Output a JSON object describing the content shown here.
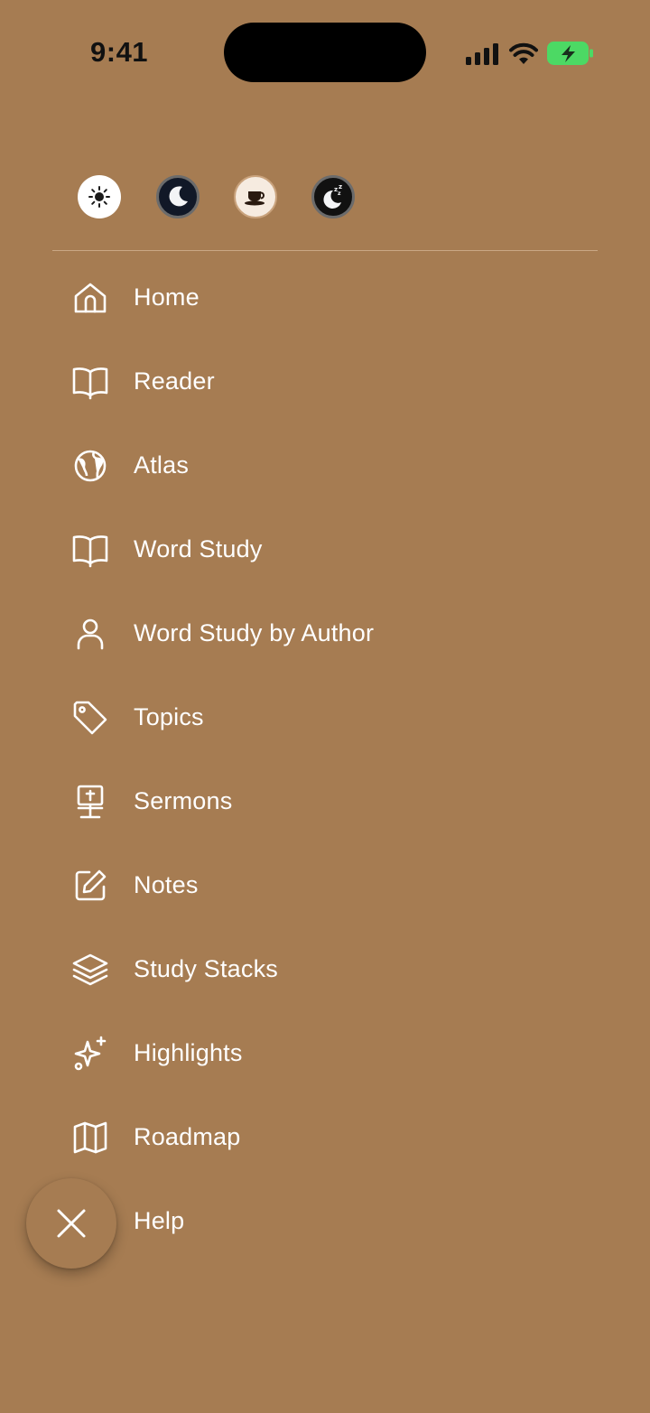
{
  "status_bar": {
    "time": "9:41"
  },
  "colors": {
    "background": "#a67c52",
    "text": "#ffffff",
    "battery_green": "#4cd964"
  },
  "theme_options": [
    {
      "name": "light",
      "icon": "sun-icon"
    },
    {
      "name": "dark",
      "icon": "moon-icon"
    },
    {
      "name": "sepia",
      "icon": "coffee-cup-icon"
    },
    {
      "name": "night",
      "icon": "moon-zzz-icon"
    }
  ],
  "menu": [
    {
      "label": "Home",
      "icon": "home-icon"
    },
    {
      "label": "Reader",
      "icon": "book-open-icon"
    },
    {
      "label": "Atlas",
      "icon": "globe-icon"
    },
    {
      "label": "Word Study",
      "icon": "book-open-icon"
    },
    {
      "label": "Word Study by Author",
      "icon": "user-icon"
    },
    {
      "label": "Topics",
      "icon": "tag-icon"
    },
    {
      "label": "Sermons",
      "icon": "pulpit-icon"
    },
    {
      "label": "Notes",
      "icon": "edit-icon"
    },
    {
      "label": "Study Stacks",
      "icon": "layers-icon"
    },
    {
      "label": "Highlights",
      "icon": "sparkles-icon"
    },
    {
      "label": "Roadmap",
      "icon": "map-icon"
    },
    {
      "label": "Help",
      "icon": "help-icon"
    }
  ],
  "close_button": {
    "icon": "close-icon"
  }
}
